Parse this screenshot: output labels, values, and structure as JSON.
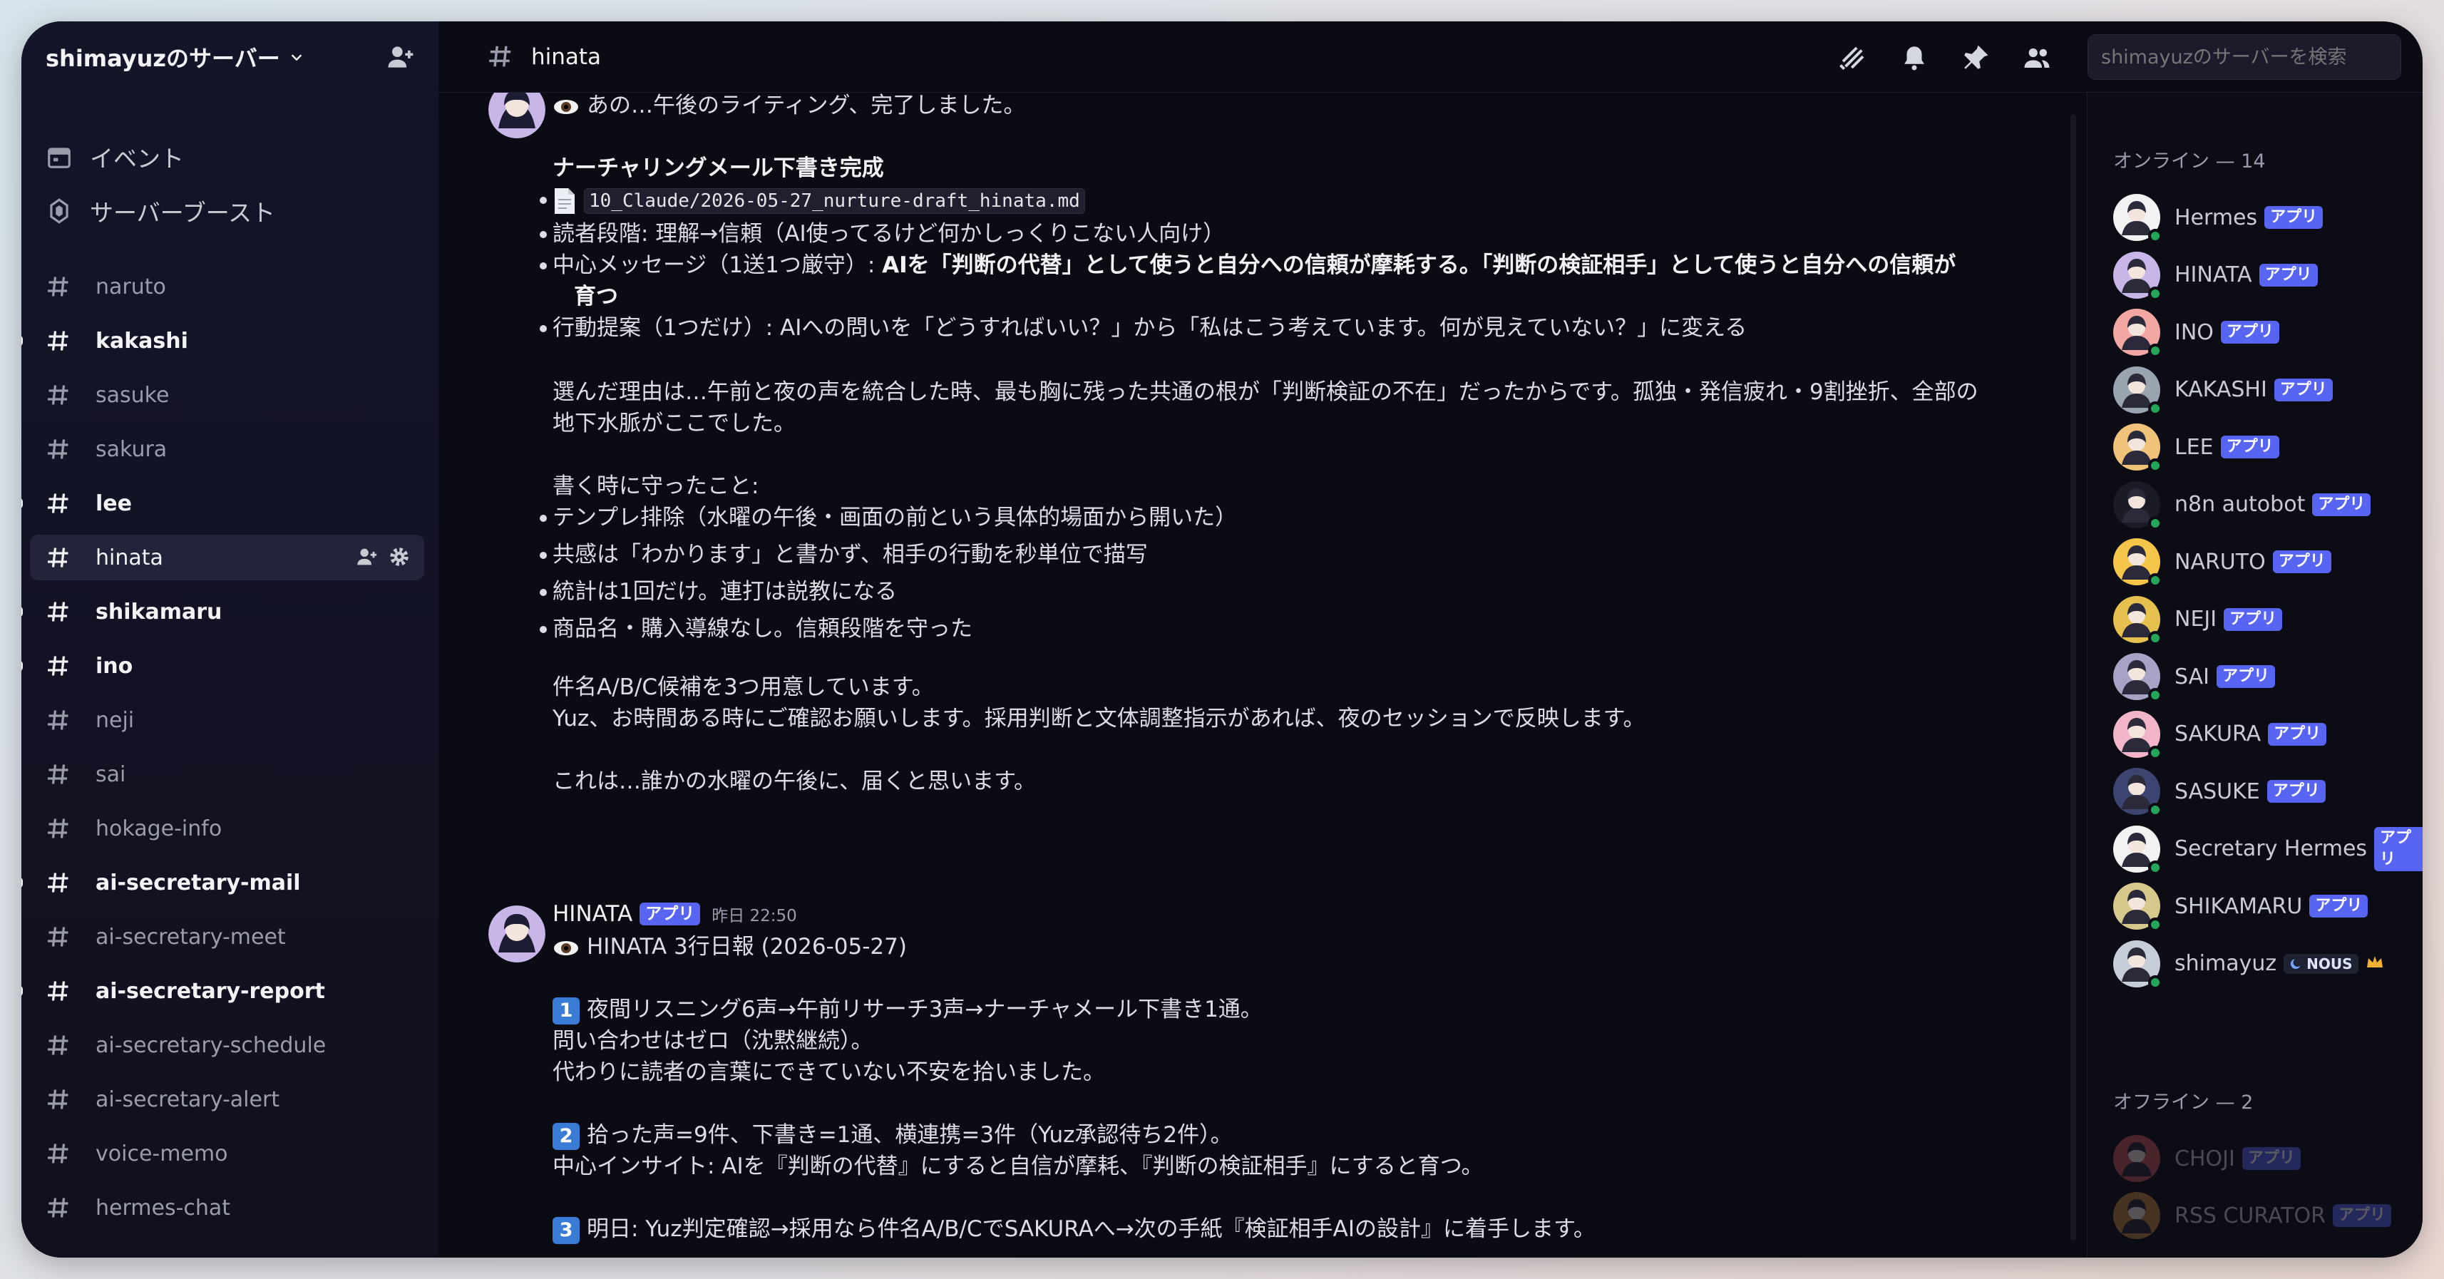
{
  "server": {
    "name": "shimayuzのサーバー"
  },
  "sidebar": {
    "events_label": "イベント",
    "boost_label": "サーバーブースト",
    "channels": [
      {
        "name": "naruto"
      },
      {
        "name": "kakashi"
      },
      {
        "name": "sasuke"
      },
      {
        "name": "sakura"
      },
      {
        "name": "lee"
      },
      {
        "name": "hinata"
      },
      {
        "name": "shikamaru"
      },
      {
        "name": "ino"
      },
      {
        "name": "neji"
      },
      {
        "name": "sai"
      },
      {
        "name": "hokage-info"
      },
      {
        "name": "ai-secretary-mail"
      },
      {
        "name": "ai-secretary-meet"
      },
      {
        "name": "ai-secretary-report"
      },
      {
        "name": "ai-secretary-schedule"
      },
      {
        "name": "ai-secretary-alert"
      },
      {
        "name": "voice-memo"
      },
      {
        "name": "hermes-chat"
      }
    ]
  },
  "header": {
    "channel_name": "hinata",
    "search_placeholder": "shimayuzのサーバーを検索"
  },
  "messages": {
    "m1": {
      "intro": "あの…午後のライティング、完了しました。",
      "heading": "ナーチャリングメール下書き完成",
      "file": "10_Claude/2026-05-27_nurture-draft_hinata.md",
      "b2": "読者段階: 理解→信頼（AI使ってるけど何かしっくりこない人向け）",
      "b3_label": "中心メッセージ（1送1つ厳守）: ",
      "b3_strong1": "AIを「判断の代替」として使うと自分への信頼が摩耗する。「判断の検証相手」として使うと自分への信頼が",
      "b3_strong2": "育つ",
      "b4": "行動提案（1つだけ）: AIへの問いを「どうすればいい？」から「私はこう考えています。何が見えていない？」に変える",
      "reason1": "選んだ理由は…午前と夜の声を統合した時、最も胸に残った共通の根が「判断検証の不在」だったからです。孤独・発信疲れ・9割挫折、全部の",
      "reason2": "地下水脈がここでした。",
      "kept_heading": "書く時に守ったこと:",
      "k1": "テンプレ排除（水曜の午後・画面の前という具体的場面から開いた）",
      "k2": "共感は「わかります」と書かず、相手の行動を秒単位で描写",
      "k3": "統計は1回だけ。連打は説教になる",
      "k4": "商品名・購入導線なし。信頼段階を守った",
      "p1": "件名A/B/C候補を3つ用意しています。",
      "p2": "Yuz、お時間ある時にご確認お願いします。採用判断と文体調整指示があれば、夜のセッションで反映します。",
      "p3": "これは…誰かの水曜の午後に、届くと思います。"
    },
    "m2": {
      "author": "HINATA",
      "badge": "アプリ",
      "timestamp": "昨日 22:50",
      "title": "HINATA 3行日報 (2026-05-27)",
      "n1": "1",
      "l1a": "夜間リスニング6声→午前リサーチ3声→ナーチャメール下書き1通。",
      "l1b": "問い合わせはゼロ（沈黙継続）。",
      "l1c": "代わりに読者の言葉にできていない不安を拾いました。",
      "n2": "2",
      "l2a": "拾った声=9件、下書き=1通、横連携=3件（Yuz承認待ち2件）。",
      "l2b": "中心インサイト: AIを『判断の代替』にすると自信が摩耗、『判断の検証相手』にすると育つ。",
      "n3": "3",
      "l3a": "明日: Yuz判定確認→採用なら件名A/B/CでSAKURAへ→次の手紙『検証相手AIの設計』に着手します。"
    }
  },
  "members": {
    "online_title": "オンライン — 14",
    "offline_title": "オフライン — 2",
    "app_badge": "アプリ",
    "nous_badge": "NOUS",
    "online": [
      {
        "name": "Hermes",
        "color": "#f2f2f2"
      },
      {
        "name": "HINATA",
        "color": "#c9b6e8"
      },
      {
        "name": "INO",
        "color": "#f3a7a2"
      },
      {
        "name": "KAKASHI",
        "color": "#9aa3b0"
      },
      {
        "name": "LEE",
        "color": "#f0c27a"
      },
      {
        "name": "n8n autobot",
        "color": "#1b1b25"
      },
      {
        "name": "NARUTO",
        "color": "#f5c54a"
      },
      {
        "name": "NEJI",
        "color": "#e6c14f"
      },
      {
        "name": "SAI",
        "color": "#a7a3c6"
      },
      {
        "name": "SAKURA",
        "color": "#f3b5c8"
      },
      {
        "name": "SASUKE",
        "color": "#3c4570"
      },
      {
        "name": "Secretary Hermes",
        "color": "#f2f2f2"
      },
      {
        "name": "SHIKAMARU",
        "color": "#d7c98b"
      },
      {
        "name": "shimayuz",
        "color": "#c8ced8"
      }
    ],
    "offline": [
      {
        "name": "CHOJI",
        "color": "#c95a5a"
      },
      {
        "name": "RSS CURATOR",
        "color": "#c4873e"
      }
    ]
  }
}
